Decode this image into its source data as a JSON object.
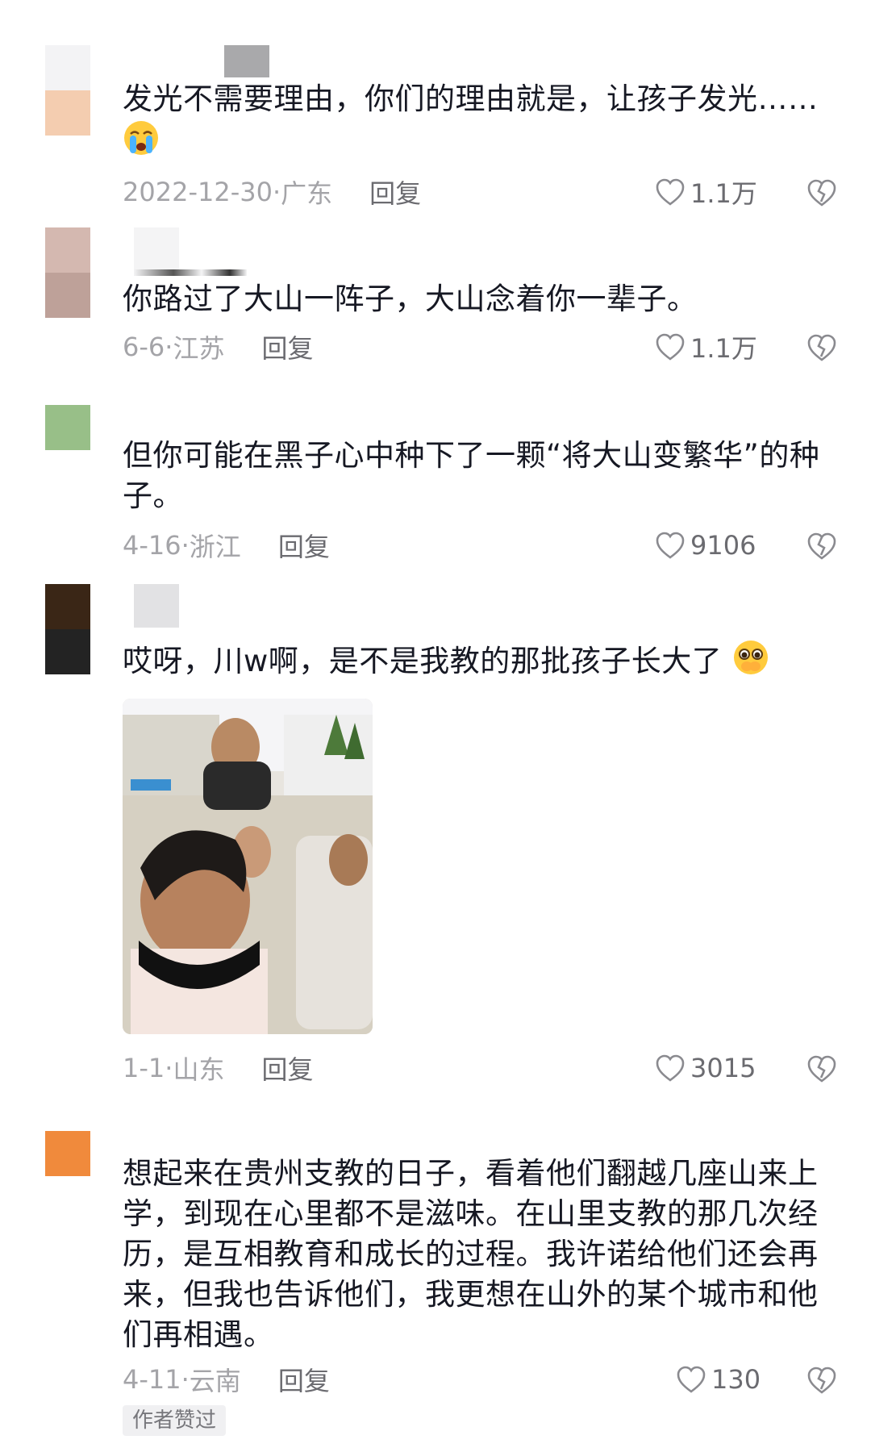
{
  "comments": [
    {
      "text": "发光不需要理由，你们的理由就是，让孩子发光……",
      "emoji": "crying-face-emoji",
      "date": "2022-12-30",
      "location": "广东",
      "reply": "回复",
      "likes": "1.1万",
      "avatar_colors": [
        "#f3f3f5",
        "#f4cdb0"
      ]
    },
    {
      "text": "你路过了大山一阵子，大山念着你一辈子。",
      "date": "6-6",
      "location": "江苏",
      "reply": "回复",
      "likes": "1.1万",
      "avatar_colors": [
        "#d4b8b0",
        "#bea199"
      ]
    },
    {
      "text": "但你可能在黑子心中种下了一颗“将大山变繁华”的种子。",
      "date": "4-16",
      "location": "浙江",
      "reply": "回复",
      "likes": "9106",
      "avatar_colors": [
        "#98bf88"
      ]
    },
    {
      "text": "哎呀，川w啊，是不是我教的那批孩子长大了",
      "emoji": "pleading-face-emoji",
      "date": "1-1",
      "location": "山东",
      "reply": "回复",
      "likes": "3015",
      "avatar_colors": [
        "#3a2616",
        "#232323"
      ]
    },
    {
      "text": "想起来在贵州支教的日子，看着他们翻越几座山来上学，到现在心里都不是滋味。在山里支教的那几次经历，是互相教育和成长的过程。我许诺给他们还会再来，但我也告诉他们，我更想在山外的某个城市和他们再相遇。",
      "date": "4-11",
      "location": "云南",
      "reply": "回复",
      "likes": "130",
      "badge": "作者赞过",
      "avatar_colors": [
        "#f08a3c"
      ]
    }
  ],
  "sep": "·"
}
